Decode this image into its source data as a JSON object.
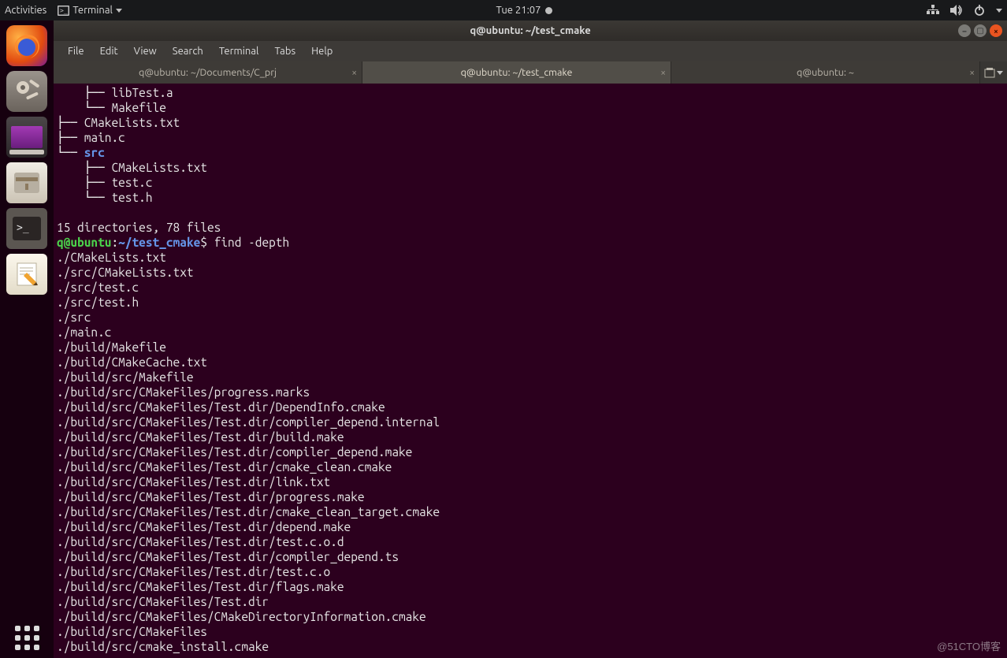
{
  "topbar": {
    "activities": "Activities",
    "app_indicator": "Terminal",
    "clock": "Tue 21:07"
  },
  "window": {
    "title": "q@ubuntu: ~/test_cmake",
    "menus": [
      "File",
      "Edit",
      "View",
      "Search",
      "Terminal",
      "Tabs",
      "Help"
    ],
    "tabs": [
      {
        "label": "q@ubuntu: ~/Documents/C_prj",
        "active": false
      },
      {
        "label": "q@ubuntu: ~/test_cmake",
        "active": true
      },
      {
        "label": "q@ubuntu: ~",
        "active": false
      }
    ]
  },
  "terminal": {
    "tree": [
      "    ├── libTest.a",
      "    └── Makefile",
      "├── CMakeLists.txt",
      "├── main.c",
      "└── src",
      "    ├── CMakeLists.txt",
      "    ├── test.c",
      "    └── test.h"
    ],
    "tree_colored_index": 4,
    "tree_colored_text": "src",
    "summary": "15 directories, 78 files",
    "prompt_user": "q@ubuntu",
    "prompt_sep": ":",
    "prompt_path": "~/test_cmake",
    "prompt_dollar": "$ ",
    "command": "find -depth",
    "find_output": [
      "./CMakeLists.txt",
      "./src/CMakeLists.txt",
      "./src/test.c",
      "./src/test.h",
      "./src",
      "./main.c",
      "./build/Makefile",
      "./build/CMakeCache.txt",
      "./build/src/Makefile",
      "./build/src/CMakeFiles/progress.marks",
      "./build/src/CMakeFiles/Test.dir/DependInfo.cmake",
      "./build/src/CMakeFiles/Test.dir/compiler_depend.internal",
      "./build/src/CMakeFiles/Test.dir/build.make",
      "./build/src/CMakeFiles/Test.dir/compiler_depend.make",
      "./build/src/CMakeFiles/Test.dir/cmake_clean.cmake",
      "./build/src/CMakeFiles/Test.dir/link.txt",
      "./build/src/CMakeFiles/Test.dir/progress.make",
      "./build/src/CMakeFiles/Test.dir/cmake_clean_target.cmake",
      "./build/src/CMakeFiles/Test.dir/depend.make",
      "./build/src/CMakeFiles/Test.dir/test.c.o.d",
      "./build/src/CMakeFiles/Test.dir/compiler_depend.ts",
      "./build/src/CMakeFiles/Test.dir/test.c.o",
      "./build/src/CMakeFiles/Test.dir/flags.make",
      "./build/src/CMakeFiles/Test.dir",
      "./build/src/CMakeFiles/CMakeDirectoryInformation.cmake",
      "./build/src/CMakeFiles",
      "./build/src/cmake_install.cmake"
    ]
  },
  "watermark": "@51CTO博客"
}
